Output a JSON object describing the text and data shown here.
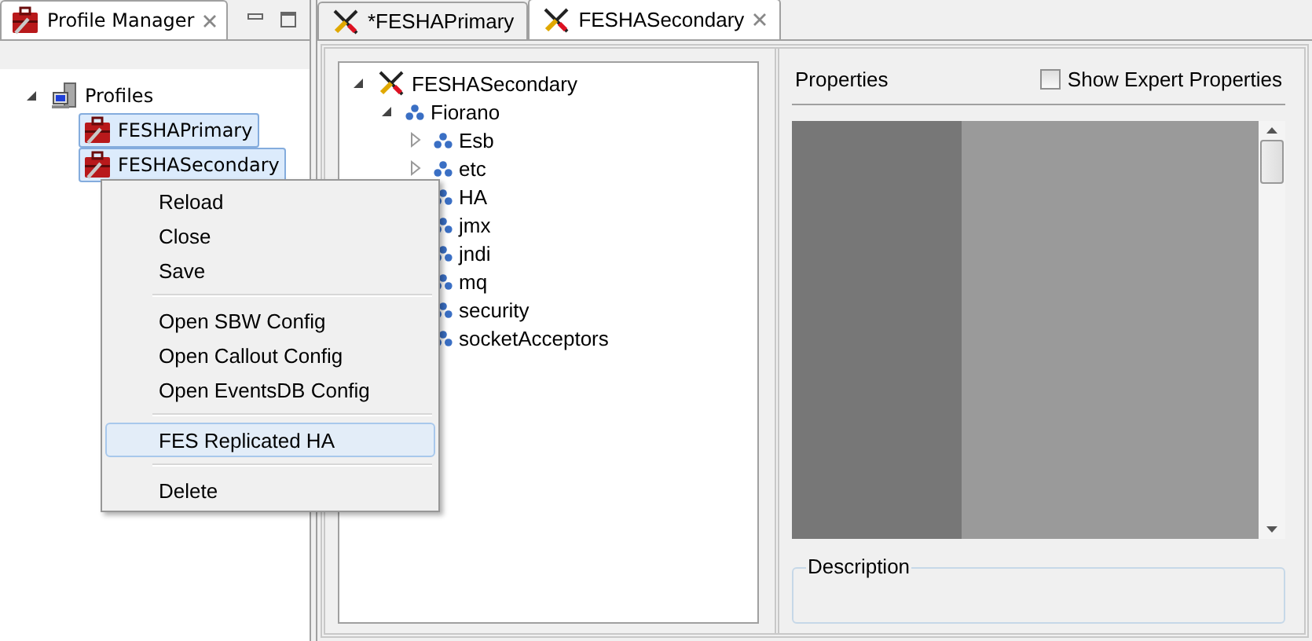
{
  "left_view": {
    "tab": {
      "label": "Profile Manager"
    },
    "tree": [
      {
        "label": "Profiles",
        "kind": "computer",
        "expanded": true,
        "children": [
          {
            "label": "FESHAPrimary",
            "kind": "profile",
            "selected": true
          },
          {
            "label": "FESHASecondary",
            "kind": "profile",
            "selected": true
          }
        ]
      }
    ]
  },
  "context_menu": {
    "groups": [
      [
        {
          "label": "Reload",
          "selected": false
        },
        {
          "label": "Close",
          "selected": false
        },
        {
          "label": "Save",
          "selected": false
        }
      ],
      [
        {
          "label": "Open SBW Config",
          "selected": false
        },
        {
          "label": "Open Callout Config",
          "selected": false
        },
        {
          "label": "Open EventsDB Config",
          "selected": false
        }
      ],
      [
        {
          "label": "FES Replicated HA",
          "selected": true
        }
      ],
      [
        {
          "label": "Delete",
          "selected": false
        }
      ]
    ]
  },
  "editor": {
    "tabs": [
      {
        "label": "*FESHAPrimary",
        "selected": false
      },
      {
        "label": "FESHASecondary",
        "selected": true
      }
    ],
    "tree": [
      {
        "label": "FESHASecondary",
        "kind": "tools",
        "expanded": true,
        "children": [
          {
            "label": "Fiorano",
            "kind": "node",
            "expanded": true,
            "children": [
              {
                "label": "Esb",
                "kind": "node",
                "expanded": false
              },
              {
                "label": "etc",
                "kind": "node",
                "expanded": false
              },
              {
                "label": "HA",
                "kind": "node"
              },
              {
                "label": "jmx",
                "kind": "node"
              },
              {
                "label": "jndi",
                "kind": "node"
              },
              {
                "label": "mq",
                "kind": "node"
              },
              {
                "label": "security",
                "kind": "node"
              },
              {
                "label": "socketAcceptors",
                "kind": "node"
              }
            ]
          }
        ]
      }
    ],
    "properties": {
      "title": "Properties",
      "show_expert": {
        "label": "Show Expert Properties",
        "checked": false
      },
      "description_label": "Description"
    }
  }
}
